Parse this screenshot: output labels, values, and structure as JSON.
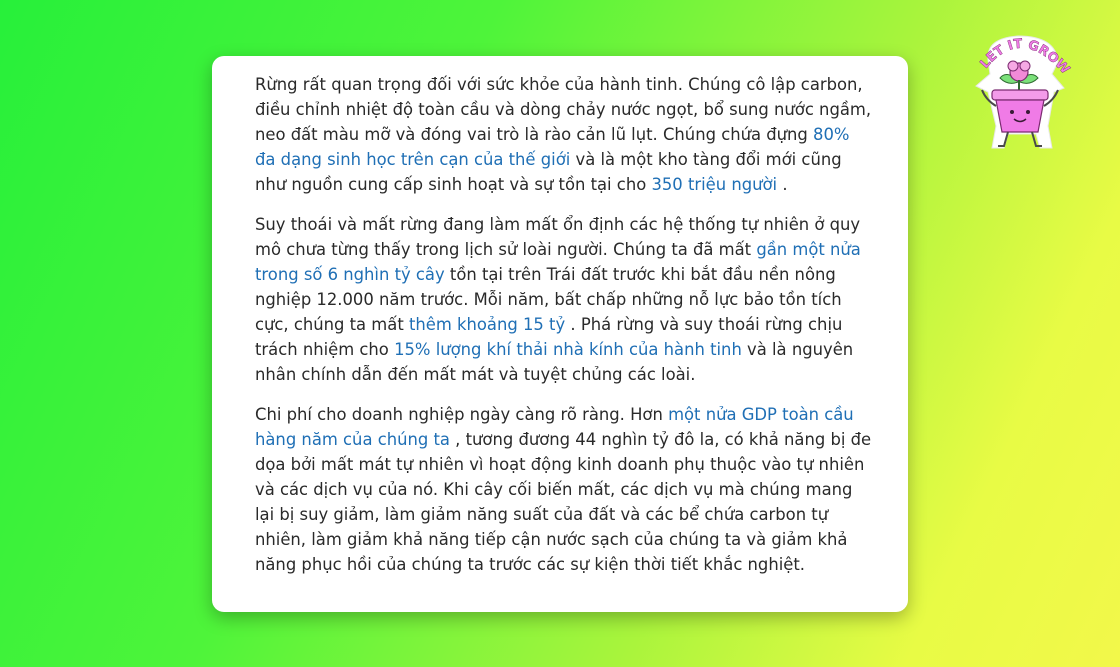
{
  "article": {
    "p1": {
      "t1": "Rừng rất quan trọng đối với sức khỏe của hành tinh. Chúng cô lập carbon, điều chỉnh nhiệt độ toàn cầu và dòng chảy nước ngọt, bổ sung nước ngầm, neo đất màu mỡ và đóng vai trò là rào cản lũ lụt. Chúng chứa đựng ",
      "link1": "80% đa dạng sinh học trên cạn của thế giới",
      "t2": " và là một kho tàng đổi mới cũng như nguồn cung cấp sinh hoạt và sự tồn tại cho ",
      "link2": "350 triệu người",
      "t3": " ."
    },
    "p2": {
      "t1": "Suy thoái và mất rừng đang làm mất ổn định các hệ thống tự nhiên ở quy mô chưa từng thấy trong lịch sử loài người. Chúng ta đã mất ",
      "link1": "gần một nửa trong số 6 nghìn tỷ cây",
      "t2": " tồn tại trên Trái đất trước khi bắt đầu nền nông nghiệp 12.000 năm trước. Mỗi năm, bất chấp những nỗ lực bảo tồn tích cực, chúng ta mất ",
      "link2": "thêm khoảng 15 tỷ",
      "t3": " . Phá rừng và suy thoái rừng chịu trách nhiệm cho ",
      "link3": "15% lượng khí thải nhà kính của hành tinh",
      "t4": " và là nguyên nhân chính dẫn đến mất mát và tuyệt chủng các loài."
    },
    "p3": {
      "t1": "Chi phí cho doanh nghiệp ngày càng rõ ràng. Hơn ",
      "link1": "một nửa GDP toàn cầu hàng năm của chúng ta",
      "t2": " , tương đương 44 nghìn tỷ đô la, có khả năng bị đe dọa bởi mất mát tự nhiên vì hoạt động kinh doanh phụ thuộc vào tự nhiên và các dịch vụ của nó. Khi cây cối biến mất, các dịch vụ mà chúng mang lại bị suy giảm, làm giảm năng suất của đất và các bể chứa carbon tự nhiên, làm giảm khả năng tiếp cận nước sạch của chúng ta và giảm khả năng phục hồi của chúng ta trước các sự kiện thời tiết khắc nghiệt."
    }
  },
  "sticker": {
    "text": "LET IT GROW",
    "icon": "flower-pot-sticker-icon"
  },
  "colors": {
    "link": "#1f6fb5",
    "text": "#2a2a2a",
    "card": "#ffffff",
    "pot": "#f07be6",
    "flower": "#f28ad8",
    "leaf": "#7be07a"
  }
}
